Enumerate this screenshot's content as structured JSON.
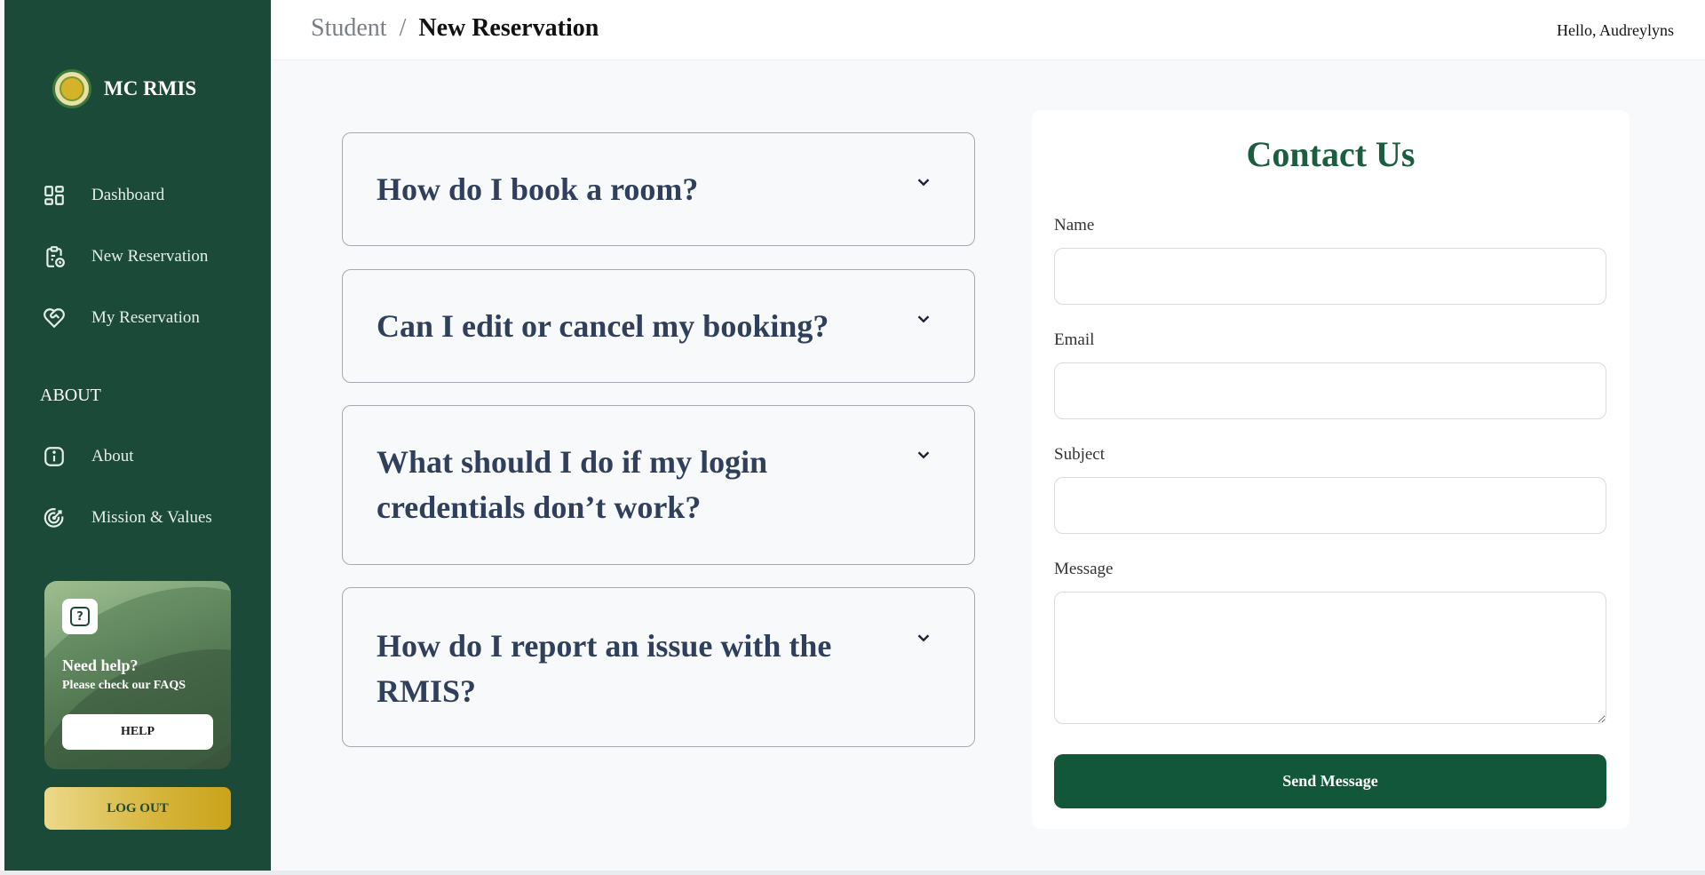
{
  "app": {
    "name": "MC RMIS"
  },
  "sidebar": {
    "items": [
      {
        "label": "Dashboard",
        "icon": "dashboard-grid-icon"
      },
      {
        "label": "New Reservation",
        "icon": "clipboard-clock-icon"
      },
      {
        "label": "My Reservation",
        "icon": "heart-hand-icon"
      }
    ],
    "section_label": "ABOUT",
    "about_items": [
      {
        "label": "About",
        "icon": "info-icon"
      },
      {
        "label": "Mission & Values",
        "icon": "target-icon"
      }
    ],
    "help": {
      "title": "Need help?",
      "subtitle": "Please check our FAQS",
      "button": "HELP",
      "icon": "question-icon"
    },
    "logout": "LOG OUT"
  },
  "header": {
    "breadcrumb": [
      "Student",
      "New Reservation"
    ],
    "separator": "/",
    "greeting": "Hello, Audreylyns"
  },
  "faqs": [
    {
      "question": "How do I book a room?"
    },
    {
      "question": "Can I edit or cancel my booking?"
    },
    {
      "question": "What should I do if my login credentials don’t work?"
    },
    {
      "question": "How do I report an issue with the RMIS?"
    }
  ],
  "contact": {
    "title": "Contact Us",
    "fields": [
      {
        "label": "Name",
        "value": ""
      },
      {
        "label": "Email",
        "value": ""
      },
      {
        "label": "Subject",
        "value": ""
      },
      {
        "label": "Message",
        "value": ""
      }
    ],
    "submit": "Send Message"
  },
  "colors": {
    "sidebar": "#1b4b38",
    "accent": "#13573b",
    "heading": "#1b5e3f",
    "faq_text": "#2f3f5c",
    "logout_gold": "#d6b53c"
  }
}
